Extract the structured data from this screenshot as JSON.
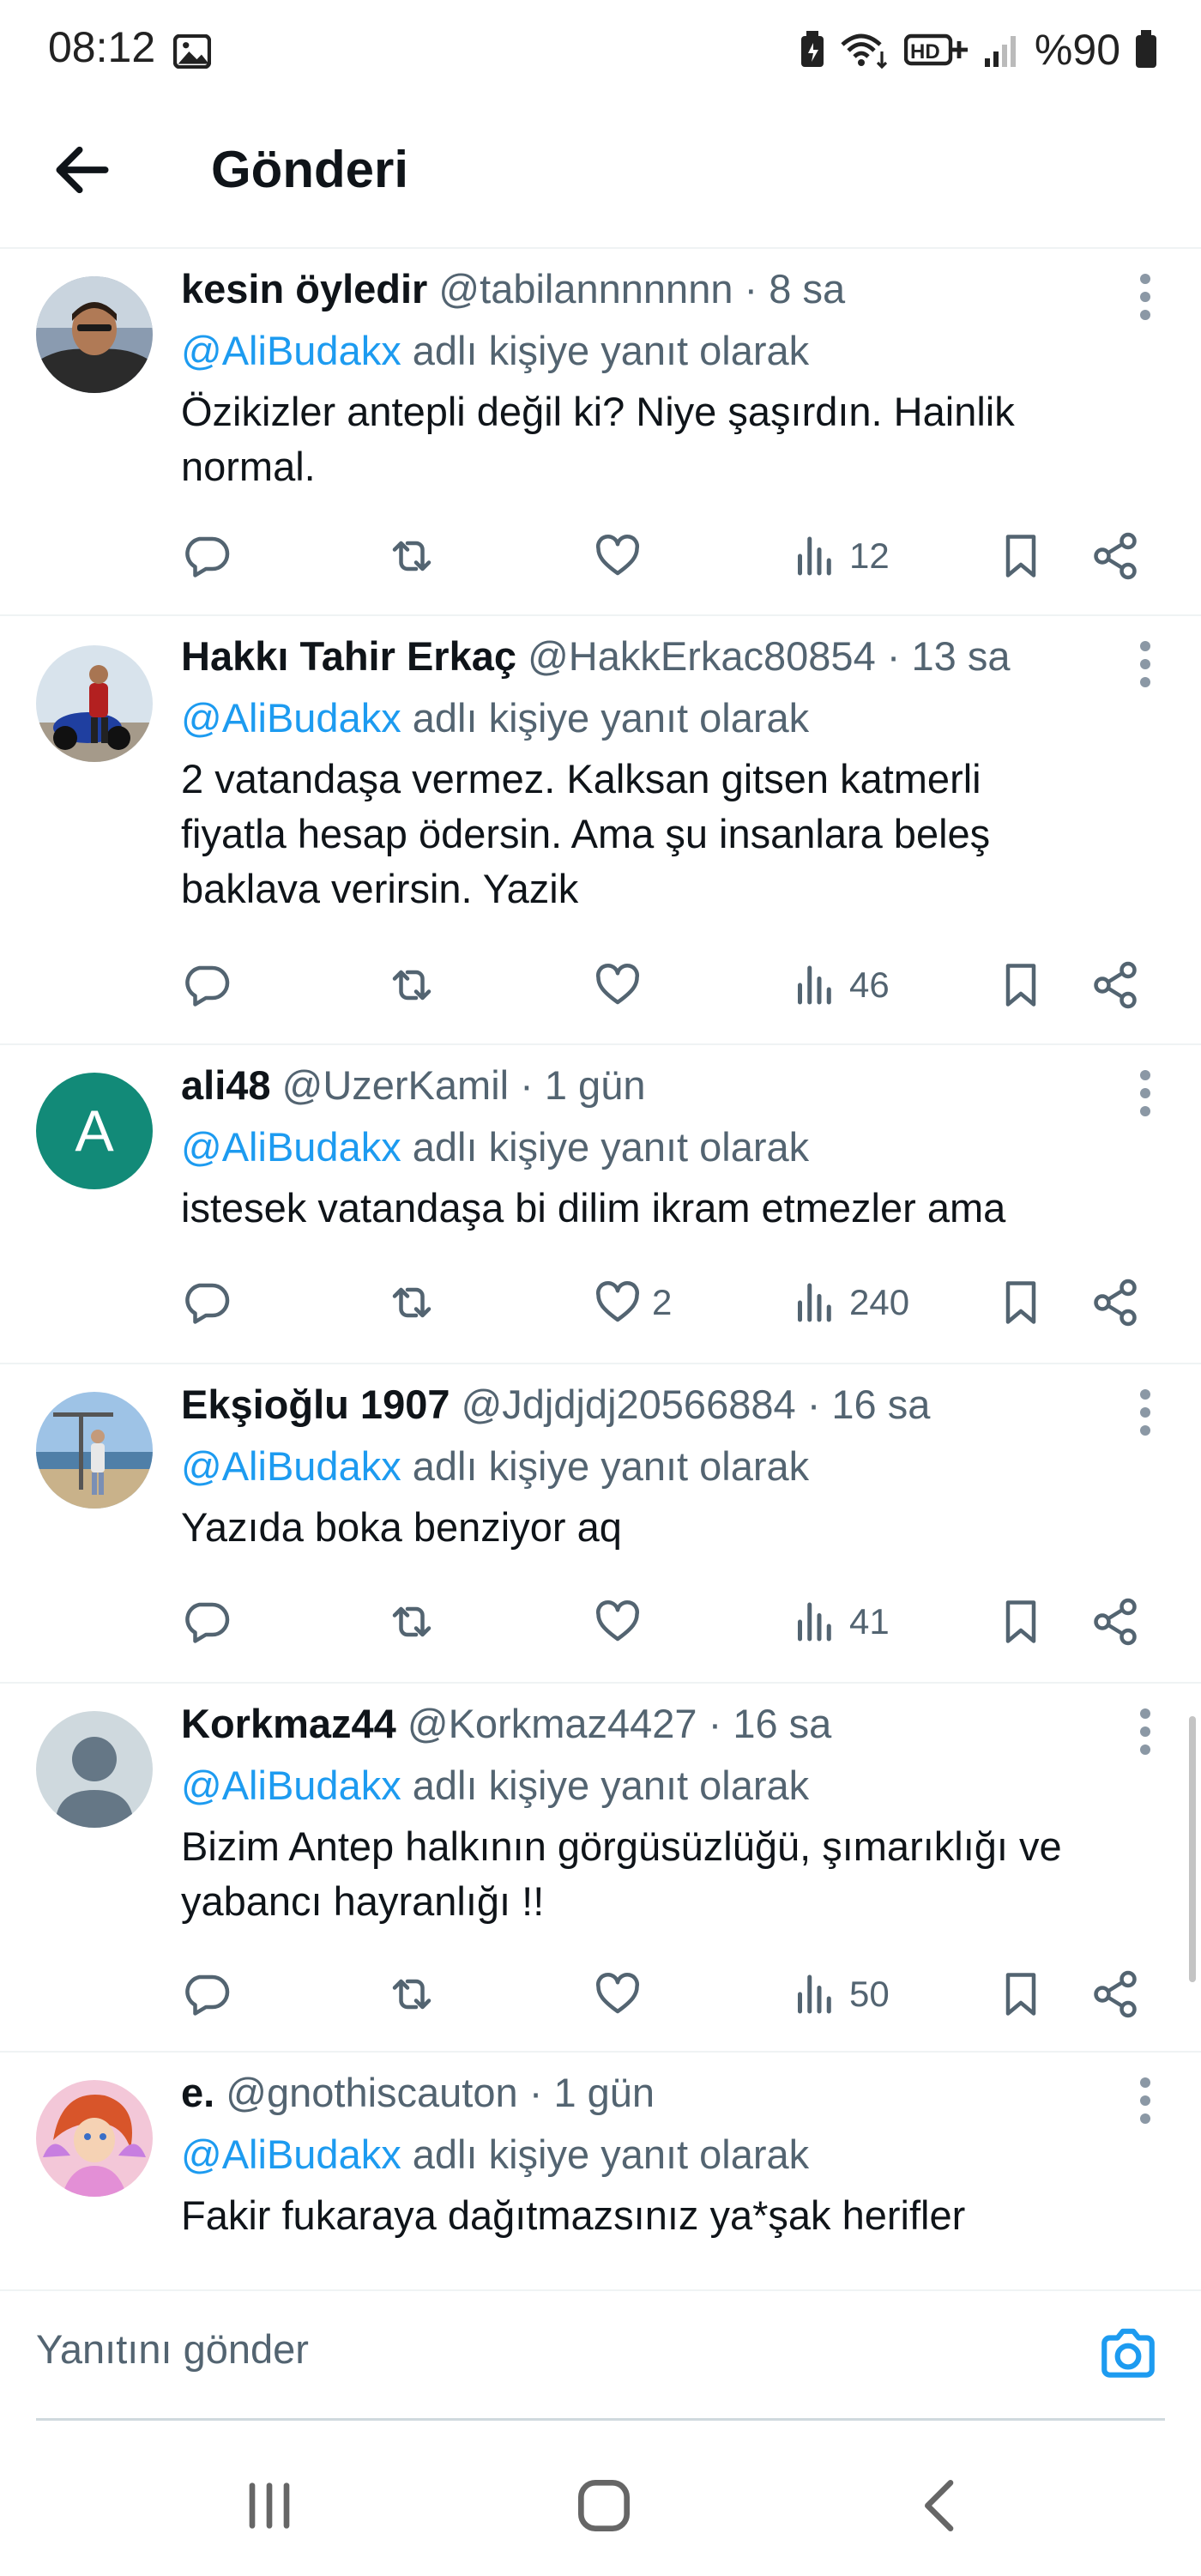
{
  "status": {
    "time": "08:12",
    "battery": "%90"
  },
  "header": {
    "title": "Gönderi"
  },
  "reply_prefix_mention": "@AliBudakx",
  "reply_prefix_text": " adlı kişiye yanıt olarak",
  "tweets": [
    {
      "name": "kesin öyledir",
      "handle": "@tabilannnnnnn",
      "time": "8 sa",
      "text_lines": [
        "Özikizler antepli değil ki? Niye şaşırdın. Hainlik",
        "normal."
      ],
      "likes": "",
      "views": "12"
    },
    {
      "name": "Hakkı Tahir Erkaç",
      "handle": "@HakkErkac80854",
      "time": "13 sa",
      "text_lines": [
        "2 vatandaşa vermez.  Kalksan gitsen katmerli",
        "fiyatla hesap ödersin. Ama şu insanlara beleş",
        "baklava verirsin. Yazik"
      ],
      "likes": "",
      "views": "46"
    },
    {
      "name": "ali48",
      "handle": "@UzerKamil",
      "time": "1 gün",
      "avatar_letter": "A",
      "text_lines": [
        "istesek vatandaşa bi dilim ikram etmezler ama"
      ],
      "likes": "2",
      "views": "240"
    },
    {
      "name": "Ekşioğlu 1907",
      "handle": "@Jdjdjdj20566884",
      "time": "16 sa",
      "text_lines": [
        "Yazıda boka benziyor aq"
      ],
      "likes": "",
      "views": "41"
    },
    {
      "name": "Korkmaz44",
      "handle": "@Korkmaz4427",
      "time": "16 sa",
      "text_lines": [
        "Bizim Antep halkının görgüsüzlüğü, şımarıklığı ve",
        "yabancı hayranlığı !!"
      ],
      "likes": "",
      "views": "50"
    },
    {
      "name": "e.",
      "handle": "@gnothiscauton",
      "time": "1 gün",
      "text_lines": [
        "Fakir fukaraya dağıtmazsınız ya*şak herifler"
      ]
    }
  ],
  "reply_box": {
    "placeholder": "Yanıtını gönder"
  },
  "colors": {
    "accent": "#1d9bf0",
    "text": "#0f1419",
    "secondary": "#536471",
    "avatar_ali48": "#128a78"
  },
  "icons": [
    "back-arrow-icon",
    "reply-icon",
    "retweet-icon",
    "like-icon",
    "views-icon",
    "bookmark-icon",
    "share-icon",
    "more-icon",
    "camera-icon"
  ]
}
